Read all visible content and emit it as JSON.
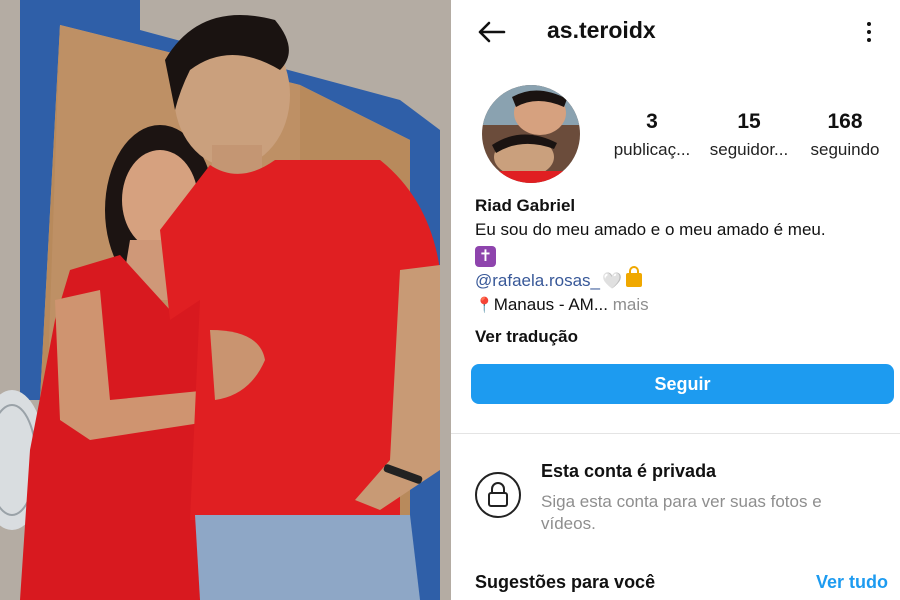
{
  "header": {
    "username": "as.teroidx",
    "back_icon": "arrow-left-icon",
    "menu_icon": "more-vertical-icon"
  },
  "stats": {
    "posts": {
      "value": "3",
      "label": "publicaç..."
    },
    "followers": {
      "value": "15",
      "label": "seguidor..."
    },
    "following": {
      "value": "168",
      "label": "seguindo"
    }
  },
  "bio": {
    "name": "Riad Gabriel",
    "line1": "Eu sou do meu amado e o meu amado é meu.",
    "emoji_cross": "✝",
    "mention": "@rafaela.rosas_",
    "emoji_heart": "🤍",
    "location": "Manaus - AM...",
    "more": "mais",
    "translate": "Ver tradução"
  },
  "actions": {
    "follow": "Seguir"
  },
  "private": {
    "title": "Esta conta é privada",
    "description": "Siga esta conta para ver suas fotos e vídeos.",
    "icon": "lock-icon"
  },
  "suggestions": {
    "title": "Sugestões para você",
    "see_all": "Ver tudo"
  },
  "colors": {
    "accent": "#1d9bf0",
    "link": "#385898",
    "muted": "#8e8e8e",
    "shirt_red": "#e01f22"
  }
}
